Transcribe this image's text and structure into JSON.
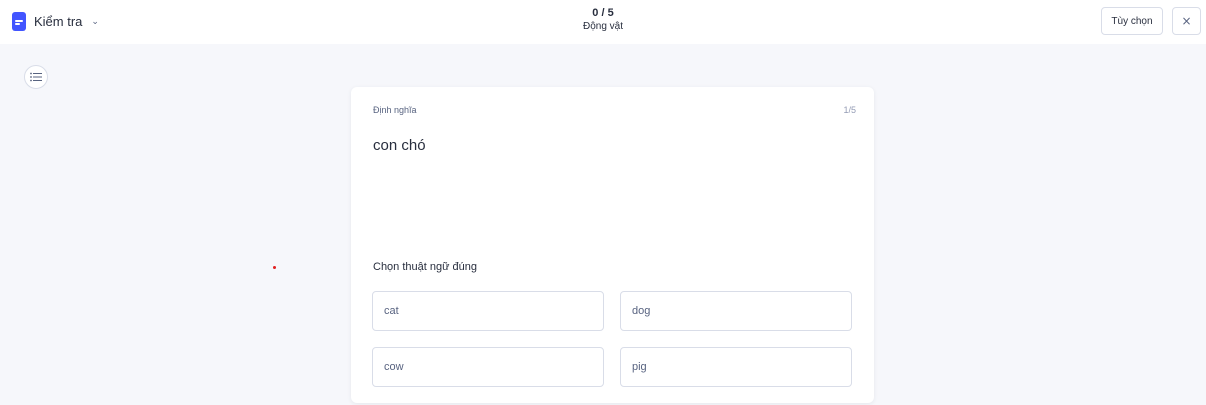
{
  "header": {
    "mode_label": "Kiểm tra",
    "mode_icon": "test-document-icon",
    "chevron": "⌄",
    "progress": "0 / 5",
    "set_title": "Động vật",
    "options_label": "Tùy chọn",
    "close_icon": "×"
  },
  "sidebar": {
    "list_icon": "list-icon"
  },
  "question": {
    "section_label": "Định nghĩa",
    "index": "1/5",
    "definition": "con chó",
    "prompt": "Chọn thuật ngữ đúng",
    "answers": [
      "cat",
      "dog",
      "cow",
      "pig"
    ]
  },
  "colors": {
    "accent": "#4255ff",
    "background": "#f6f7fb",
    "text": "#282e3e",
    "border": "#d9dde8"
  }
}
